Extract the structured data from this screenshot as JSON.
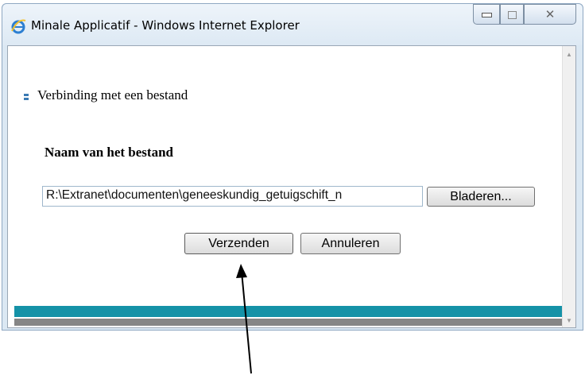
{
  "window": {
    "title": "Minale Applicatif - Windows Internet Explorer"
  },
  "page": {
    "section_title": "Verbinding met een bestand",
    "file_label": "Naam van het bestand",
    "file_value": "R:\\Extranet\\documenten\\geneeskundig_getuigschift_n",
    "browse_label": "Bladeren...",
    "send_label": "Verzenden",
    "cancel_label": "Annuleren"
  },
  "colors": {
    "teal_bar": "#1592a7",
    "gray_bar": "#868686"
  },
  "icons": [
    "ie-logo-icon",
    "minimize-icon",
    "maximize-icon",
    "close-icon",
    "scroll-up-icon",
    "scroll-down-icon",
    "bullet-icon",
    "annotation-arrow"
  ]
}
